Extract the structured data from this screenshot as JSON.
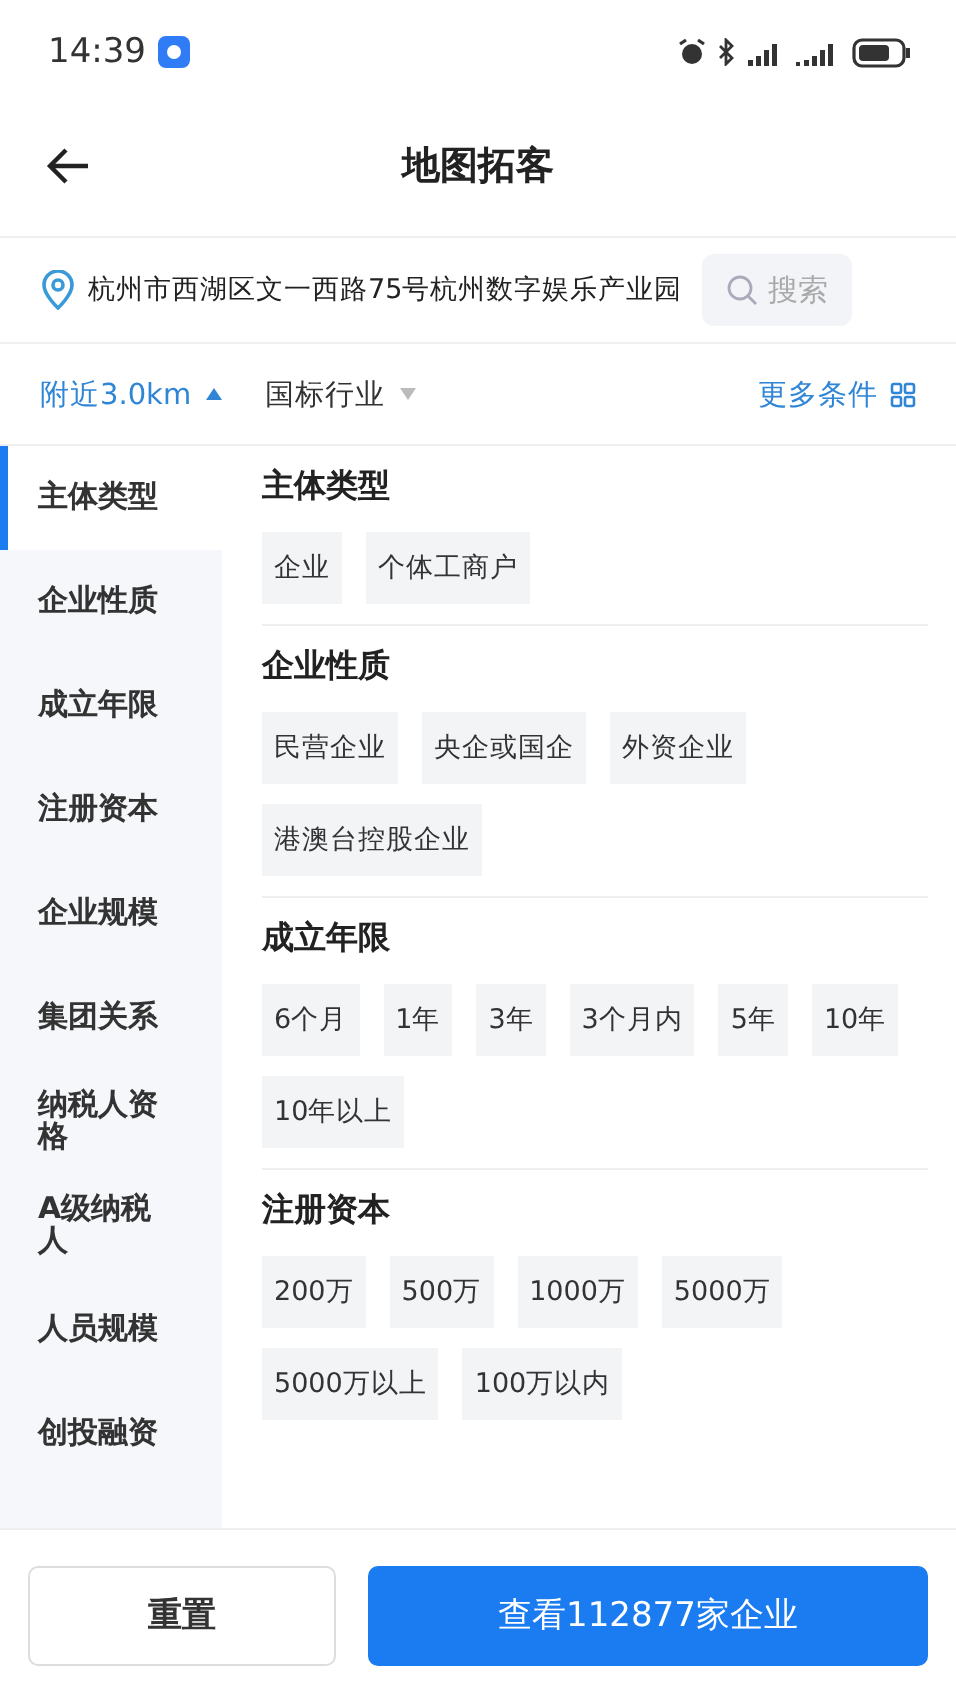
{
  "status_bar": {
    "time": "14:39"
  },
  "header": {
    "title": "地图拓客"
  },
  "location": {
    "address": "杭州市西湖区文一西路75号杭州数字娱乐产业园",
    "search_label": "搜索"
  },
  "filters": [
    {
      "label": "附近3.0km",
      "expanded": true
    },
    {
      "label": "国标行业",
      "expanded": false
    }
  ],
  "more_filters": "更多条件",
  "sidebar": [
    {
      "label": "主体类型",
      "selected": true
    },
    {
      "label": "企业性质",
      "selected": false
    },
    {
      "label": "成立年限",
      "selected": false
    },
    {
      "label": "注册资本",
      "selected": false
    },
    {
      "label": "企业规模",
      "selected": false
    },
    {
      "label": "集团关系",
      "selected": false
    },
    {
      "label": "纳税人资格",
      "selected": false
    },
    {
      "label": "A级纳税人",
      "selected": false
    },
    {
      "label": "人员规模",
      "selected": false
    },
    {
      "label": "创投融资",
      "selected": false
    }
  ],
  "sections": [
    {
      "title": "主体类型",
      "options": [
        "企业",
        "个体工商户"
      ]
    },
    {
      "title": "企业性质",
      "options": [
        "民营企业",
        "央企或国企",
        "外资企业",
        "港澳台控股企业"
      ]
    },
    {
      "title": "成立年限",
      "options": [
        "6个月",
        "1年",
        "3年",
        "3个月内",
        "5年",
        "10年",
        "10年以上"
      ]
    },
    {
      "title": "注册资本",
      "options": [
        "200万",
        "500万",
        "1000万",
        "5000万",
        "5000万以上",
        "100万以内"
      ]
    }
  ],
  "buttons": {
    "reset": "重置",
    "confirm": "查看112877家企业"
  }
}
